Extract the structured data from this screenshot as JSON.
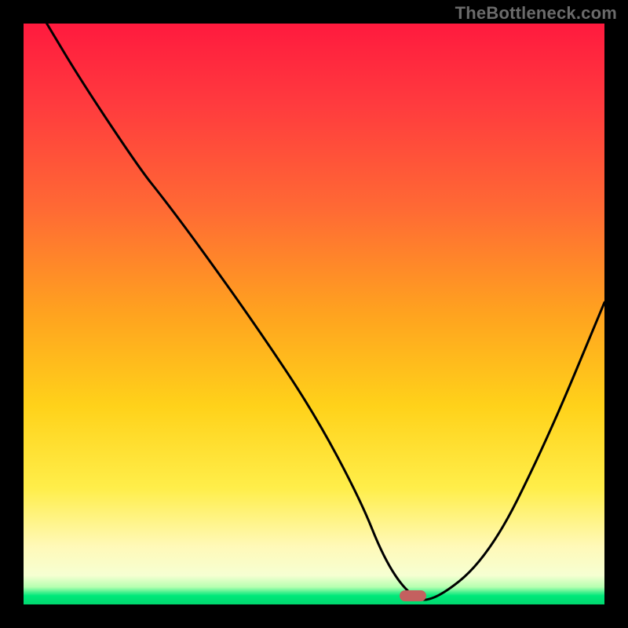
{
  "watermark": "TheBottleneck.com",
  "chart_data": {
    "type": "line",
    "title": "",
    "xlabel": "",
    "ylabel": "",
    "xlim": [
      0,
      100
    ],
    "ylim": [
      0,
      100
    ],
    "grid": false,
    "legend": false,
    "series": [
      {
        "name": "bottleneck-curve",
        "x": [
          4,
          10,
          20,
          24,
          30,
          40,
          50,
          58,
          62,
          66,
          70,
          80,
          90,
          100
        ],
        "y": [
          100,
          90,
          75,
          70,
          62,
          48,
          33,
          18,
          8,
          2,
          0,
          8,
          28,
          52
        ]
      }
    ],
    "marker": {
      "x": 67,
      "y": 1.5,
      "color": "#c4605f"
    },
    "gradient_stops": [
      {
        "pos": 0,
        "color": "#ff1a3e"
      },
      {
        "pos": 0.14,
        "color": "#ff3b3e"
      },
      {
        "pos": 0.32,
        "color": "#ff6a34"
      },
      {
        "pos": 0.5,
        "color": "#ffa31f"
      },
      {
        "pos": 0.66,
        "color": "#ffd21a"
      },
      {
        "pos": 0.8,
        "color": "#ffee4a"
      },
      {
        "pos": 0.9,
        "color": "#fff9b8"
      },
      {
        "pos": 0.95,
        "color": "#f6ffd2"
      },
      {
        "pos": 0.97,
        "color": "#b6ffb0"
      },
      {
        "pos": 0.985,
        "color": "#00e87a"
      },
      {
        "pos": 1.0,
        "color": "#00d86f"
      }
    ]
  }
}
